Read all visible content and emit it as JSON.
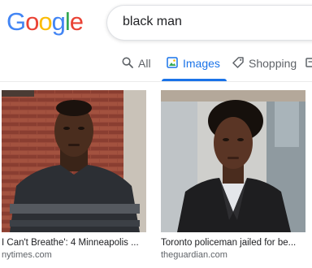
{
  "logo": {
    "letters": [
      "G",
      "o",
      "o",
      "g",
      "l",
      "e"
    ],
    "colors": [
      "#4285F4",
      "#EA4335",
      "#FBBC05",
      "#4285F4",
      "#34A853",
      "#EA4335"
    ]
  },
  "search": {
    "query": "black man"
  },
  "tabs": [
    {
      "label": "All",
      "icon": "search-icon"
    },
    {
      "label": "Images",
      "icon": "image-icon",
      "active": true
    },
    {
      "label": "Shopping",
      "icon": "tag-icon"
    }
  ],
  "results": [
    {
      "caption": "I Can't Breathe': 4 Minneapolis ...",
      "source": "nytimes.com"
    },
    {
      "caption": "Toronto policeman jailed for be...",
      "source": "theguardian.com"
    }
  ],
  "accent": "#1a73e8"
}
